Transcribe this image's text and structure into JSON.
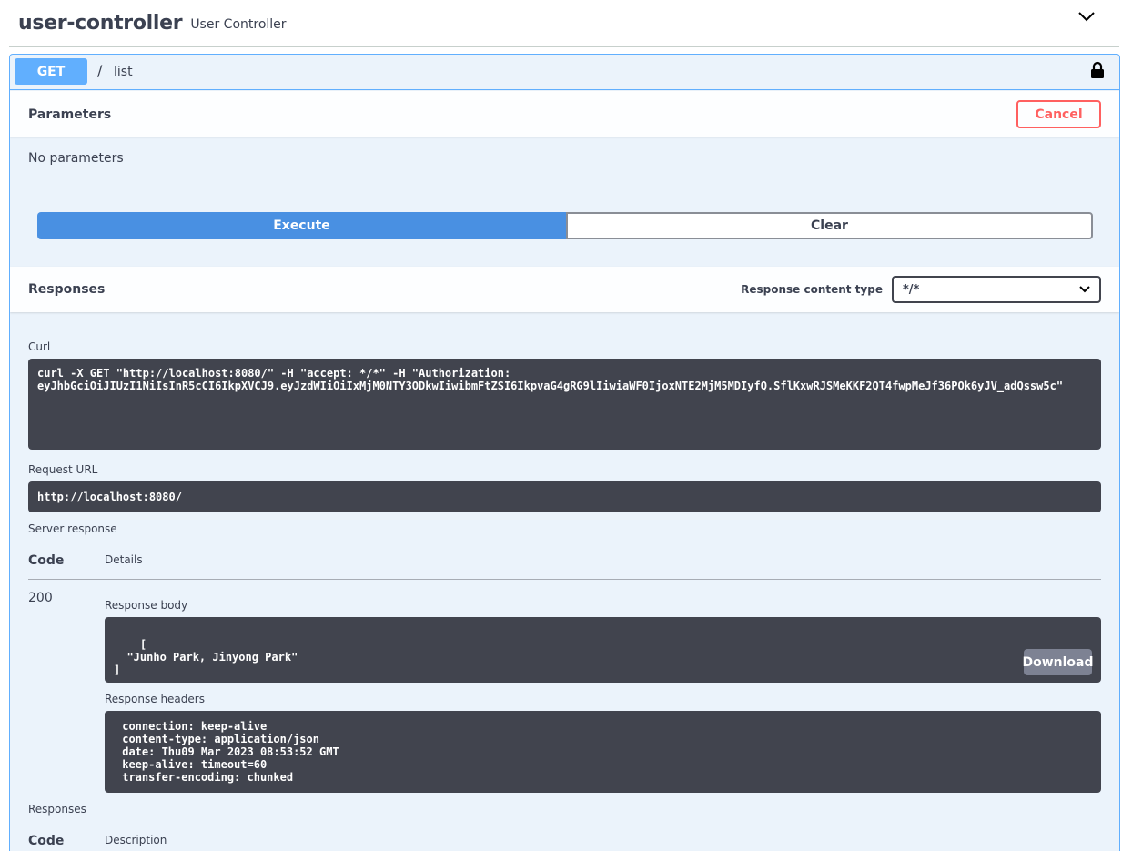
{
  "tag": {
    "name": "user-controller",
    "description": "User Controller"
  },
  "operation": {
    "method": "GET",
    "slash": "/",
    "path": "list"
  },
  "parameters": {
    "title": "Parameters",
    "cancel_label": "Cancel",
    "empty_text": "No parameters"
  },
  "actions": {
    "execute_label": "Execute",
    "clear_label": "Clear"
  },
  "responses_section": {
    "title": "Responses",
    "content_type_label": "Response content type",
    "content_type_value": "*/*"
  },
  "curl": {
    "label": "Curl",
    "text": "curl -X GET \"http://localhost:8080/\" -H \"accept: */*\" -H \"Authorization: \neyJhbGciOiJIUzI1NiIsInR5cCI6IkpXVCJ9.eyJzdWIiOiIxMjM0NTY3ODkwIiwibmFtZSI6IkpvaG4gRG9lIiwiaWF0IjoxNTE2MjM5MDIyfQ.SflKxwRJSMeKKF2QT4fwpMeJf36POk6yJV_adQssw5c\""
  },
  "request_url": {
    "label": "Request URL",
    "value": "http://localhost:8080/"
  },
  "server_response": {
    "label": "Server response",
    "code_header": "Code",
    "details_header": "Details",
    "code": "200",
    "body_label": "Response body",
    "body": "[\n  \"Junho Park, Jinyong Park\"\n]",
    "download_label": "Download",
    "headers_label": "Response headers",
    "headers": " connection: keep-alive \n content-type: application/json \n date: Thu09 Mar 2023 08:53:52 GMT \n keep-alive: timeout=60 \n transfer-encoding: chunked "
  },
  "responses_table": {
    "label": "Responses",
    "code_header": "Code",
    "description_header": "Description"
  },
  "colors": {
    "get_accent": "#61affe",
    "execute_blue": "#4990e2",
    "cancel_red": "#ff6060",
    "code_bg": "#41444e",
    "opblock_bg": "#ebf3fb"
  }
}
